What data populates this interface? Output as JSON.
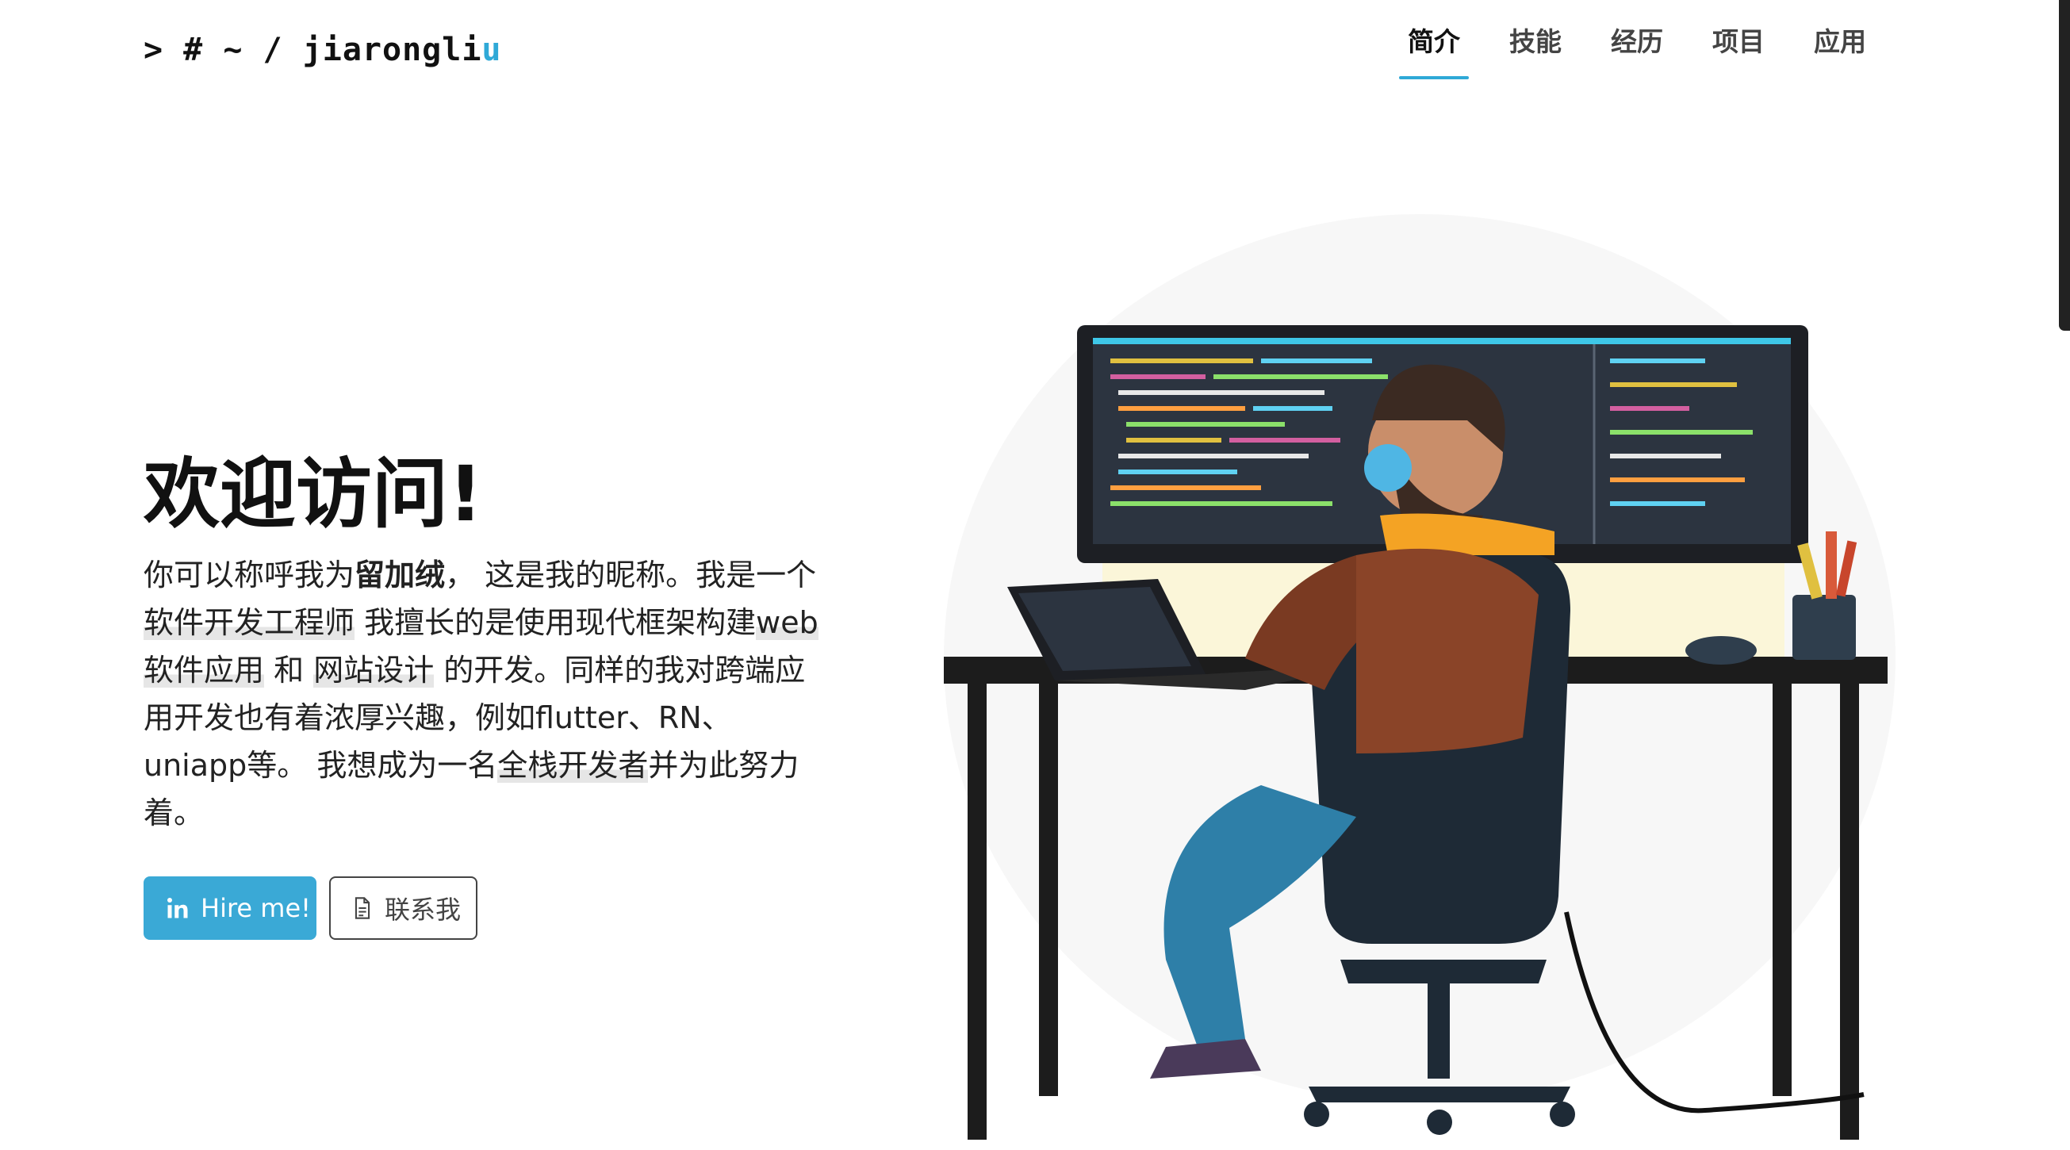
{
  "logo": {
    "prefix": "> # ~ / jiarongli",
    "accent": "u"
  },
  "nav": {
    "items": [
      {
        "label": "简介",
        "active": true
      },
      {
        "label": "技能",
        "active": false
      },
      {
        "label": "经历",
        "active": false
      },
      {
        "label": "项目",
        "active": false
      },
      {
        "label": "应用",
        "active": false
      }
    ]
  },
  "hero": {
    "title": "欢迎访问!",
    "para": {
      "t1": "你可以称呼我为",
      "nickname": "留加绒",
      "t2": "， 这是我的昵称。我是一个 ",
      "role": "软件开发工程师",
      "t3": " 我擅长的是使用现代框架构建",
      "skill1": "web软件应用",
      "t4": " 和 ",
      "skill2": "网站设计",
      "t5": " 的开发。同样的我对跨端应用开发也有着浓厚兴趣，例如flutter、RN、uniapp等。 我想成为一名",
      "goal": "全栈开发者",
      "t6": "并为此努力着。"
    },
    "buttons": {
      "hire": "Hire me!",
      "contact": "联系我"
    }
  },
  "colors": {
    "accent": "#2fa9d7",
    "button_primary": "#3aa9d6"
  },
  "icons": {
    "hire": "linkedin-icon",
    "contact": "document-icon"
  }
}
